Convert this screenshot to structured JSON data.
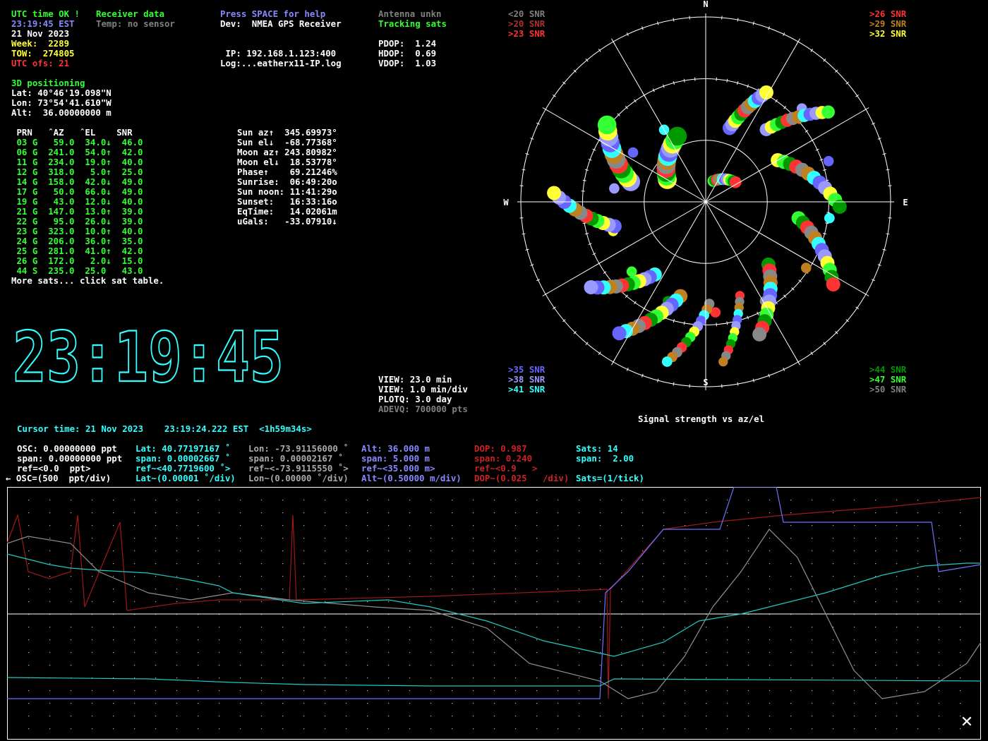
{
  "status": {
    "utc_ok": "UTC time OK !",
    "receiver_data": "Receiver data",
    "time": "23:19:45 EST",
    "temp": "Temp: no sensor",
    "date": "21 Nov 2023",
    "week": "Week:  2289",
    "tow": "TOW:  274805",
    "utc_ofs": "UTC ofs: 21",
    "help": "Press SPACE for help",
    "dev": "Dev:  NMEA GPS Receiver",
    "ip": " IP: 192.168.1.123:400",
    "log": "Log:...eatherx11-IP.log",
    "antenna": "Antenna unkn",
    "tracking": "Tracking sats",
    "pdop": "PDOP:  1.24",
    "hdop": "HDOP:  0.69",
    "vdop": "VDOP:  1.03"
  },
  "position": {
    "mode": "3D positioning",
    "lat": "Lat: 40°46'19.098\"N",
    "lon": "Lon: 73°54'41.610\"W",
    "alt": "Alt:  36.00000000 m"
  },
  "sat_table": {
    "header": " PRN   ˆAZ   ˆEL    SNR",
    "rows": [
      " 03 G   59.0  34.0↓  46.0",
      " 06 G  241.0  54.0↑  42.0",
      " 11 G  234.0  19.0↑  40.0",
      " 12 G  318.0   5.0↑  25.0",
      " 14 G  158.0  42.0↓  49.0",
      " 17 G   50.0  66.0↓  49.0",
      " 19 G   43.0  12.0↓  40.0",
      " 21 G  147.0  13.0↑  39.0",
      " 22 G   95.0  26.0↓  39.0",
      " 23 G  323.0  10.0↑  40.0",
      " 24 G  206.0  36.0↑  35.0",
      " 25 G  281.0  41.0↑  42.0",
      " 26 G  172.0   2.0↓  15.0",
      " 44 S  235.0  25.0   43.0"
    ],
    "more": "More sats... click sat table."
  },
  "astro": [
    "Sun az↑  345.69973°",
    "Sun el↓  -68.77368°",
    "Moon az↑ 243.80982°",
    "Moon el↓  18.53778°",
    "Phase↑    69.21246%",
    "Sunrise:  06:49:20o",
    "Sun noon: 11:41:29o",
    "Sunset:   16:33:16o",
    "EqTime:   14.02061m",
    "uGals:   -33.07910↓"
  ],
  "big_clock": "23:19:45",
  "view": {
    "view_min": "VIEW: 23.0 min",
    "view_div": "VIEW: 1.0 min/div",
    "plotq": "PLOTQ: 3.0 day",
    "adevq": "ADEVQ: 700000 pts"
  },
  "sky": {
    "caption": "Signal strength vs az/el",
    "compass": {
      "n": "N",
      "s": "S",
      "e": "E",
      "w": "W"
    },
    "legend_tl": [
      "<20 SNR",
      ">20 SNR",
      ">23 SNR"
    ],
    "legend_tr": [
      ">26 SNR",
      ">29 SNR",
      ">32 SNR"
    ],
    "legend_bl": [
      ">35 SNR",
      ">38 SNR",
      ">41 SNR"
    ],
    "legend_br": [
      ">44 SNR",
      ">47 SNR",
      ">50 SNR"
    ]
  },
  "cursor": "Cursor time: 21 Nov 2023    23:19:24.222 EST  <1h59m34s>",
  "plot_params": {
    "osc": [
      "OSC: 0.00000000 ppt",
      "span: 0.00000000 ppt",
      "ref=<0.0  ppt>",
      "← OSC=(500  ppt/div)"
    ],
    "lat": [
      "Lat: 40.77197167 ˚",
      "span: 0.00002667 ˚",
      "ref~<40.7719600 ˚>",
      "Lat~(0.00001 ˚/div)"
    ],
    "lon": [
      "Lon: -73.91156000 ˚",
      "span: 0.00002167 ˚",
      "ref~<-73.9115550 ˚>",
      "Lon~(0.00000 ˚/div)"
    ],
    "alt": [
      "Alt: 36.000 m",
      "span: 5.000 m",
      "ref~<35.000 m>",
      "Alt~(0.50000 m/div)"
    ],
    "dop": [
      "DOP: 0.987",
      "span: 0.240",
      "ref~<0.9   >",
      "DOP~(0.025   /div)"
    ],
    "sats": [
      "Sats: 14",
      "span:  2.00",
      "",
      "Sats=(1/tick)"
    ]
  },
  "close_label": "✕"
}
